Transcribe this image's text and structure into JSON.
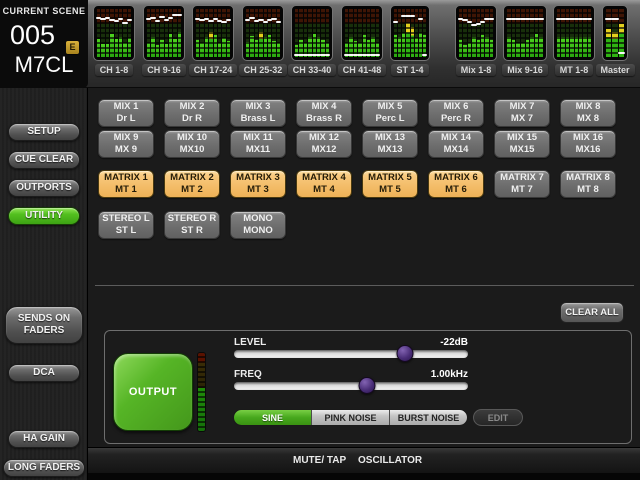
{
  "scene": {
    "label": "CURRENT SCENE",
    "number": "005",
    "edit_badge": "E",
    "model": "M7CL"
  },
  "meters": {
    "blocks": [
      {
        "label": "CH 1-8",
        "bars": [
          38,
          28,
          28,
          48,
          38,
          42,
          30,
          40
        ],
        "markers": [
          80,
          77,
          80,
          74,
          72,
          77,
          68,
          74
        ],
        "yellow": []
      },
      {
        "label": "CH 9-16",
        "bars": [
          30,
          42,
          25,
          35,
          28,
          48,
          38,
          52
        ],
        "markers": [
          77,
          80,
          72,
          82,
          75,
          80,
          85,
          85
        ],
        "yellow": []
      },
      {
        "label": "CH 17-24",
        "bars": [
          36,
          30,
          42,
          52,
          46,
          30,
          40,
          34
        ],
        "markers": [
          78,
          74,
          77,
          72,
          78,
          73,
          70,
          76
        ],
        "yellow": [
          3
        ]
      },
      {
        "label": "CH 25-32",
        "bars": [
          32,
          44,
          36,
          52,
          42,
          46,
          34,
          30
        ],
        "markers": [
          76,
          79,
          73,
          76,
          71,
          74,
          78,
          71
        ],
        "yellow": [
          3
        ]
      },
      {
        "label": "CH 33-40",
        "bars": [
          26,
          36,
          30,
          42,
          48,
          42,
          36,
          30
        ],
        "markers": [
          3,
          3,
          3,
          3,
          3,
          3,
          3,
          3
        ],
        "yellow": []
      },
      {
        "label": "CH 41-48",
        "bars": [
          30,
          42,
          34,
          30,
          46,
          36,
          42,
          30
        ],
        "markers": [
          3,
          3,
          3,
          3,
          3,
          3,
          3,
          3
        ],
        "yellow": []
      },
      {
        "label": "ST 1-4",
        "bars": [
          46,
          42,
          50,
          70,
          62,
          40,
          50,
          46
        ],
        "markers": [
          70,
          null,
          84,
          84,
          84,
          null,
          78,
          3
        ],
        "yellow": [
          3,
          4
        ]
      },
      {
        "label": "Mix 1-8",
        "bars": [
          36,
          26,
          30,
          42,
          36,
          46,
          42,
          36
        ],
        "markers": [
          78,
          74,
          70,
          64,
          67,
          71,
          77,
          77
        ],
        "yellow": []
      },
      {
        "label": "Mix 9-16",
        "bars": [
          42,
          36,
          30,
          30,
          36,
          42,
          48,
          42
        ],
        "markers": [
          77,
          77,
          77,
          77,
          77,
          77,
          77,
          77
        ],
        "yellow": []
      },
      {
        "label": "MT 1-8",
        "bars": [
          42,
          42,
          42,
          42,
          42,
          42,
          42,
          42
        ],
        "markers": [
          77,
          77,
          77,
          77,
          77,
          77,
          77,
          77
        ],
        "yellow": []
      },
      {
        "label": "Master",
        "bars": [
          58,
          52,
          68
        ],
        "markers": [
          78,
          78,
          6
        ],
        "yellow": [
          0,
          1,
          2
        ]
      }
    ]
  },
  "sidebar": {
    "items": [
      {
        "label": "SETUP",
        "active": false
      },
      {
        "label": "CUE CLEAR",
        "active": false
      },
      {
        "label": "OUTPORTS",
        "active": false
      },
      {
        "label": "UTILITY",
        "active": true
      },
      {
        "label": "SENDS ON\nFADERS",
        "active": false
      },
      {
        "label": "DCA",
        "active": false
      },
      {
        "label": "HA GAIN",
        "active": false
      },
      {
        "label": "LONG FADERS",
        "active": false
      }
    ]
  },
  "channel_grid": {
    "rows": [
      [
        {
          "line1": "MIX 1",
          "line2": "Dr L",
          "state": "gray"
        },
        {
          "line1": "MIX 2",
          "line2": "Dr R",
          "state": "gray"
        },
        {
          "line1": "MIX 3",
          "line2": "Brass L",
          "state": "gray"
        },
        {
          "line1": "MIX 4",
          "line2": "Brass R",
          "state": "gray"
        },
        {
          "line1": "MIX 5",
          "line2": "Perc L",
          "state": "gray"
        },
        {
          "line1": "MIX 6",
          "line2": "Perc R",
          "state": "gray"
        },
        {
          "line1": "MIX 7",
          "line2": "MX 7",
          "state": "gray"
        },
        {
          "line1": "MIX 8",
          "line2": "MX 8",
          "state": "gray"
        }
      ],
      [
        {
          "line1": "MIX 9",
          "line2": "MX 9",
          "state": "gray"
        },
        {
          "line1": "MIX 10",
          "line2": "MX10",
          "state": "gray"
        },
        {
          "line1": "MIX 11",
          "line2": "MX11",
          "state": "gray"
        },
        {
          "line1": "MIX 12",
          "line2": "MX12",
          "state": "gray"
        },
        {
          "line1": "MIX 13",
          "line2": "MX13",
          "state": "gray"
        },
        {
          "line1": "MIX 14",
          "line2": "MX14",
          "state": "gray"
        },
        {
          "line1": "MIX 15",
          "line2": "MX15",
          "state": "gray"
        },
        {
          "line1": "MIX 16",
          "line2": "MX16",
          "state": "gray"
        }
      ],
      [
        {
          "line1": "MATRIX 1",
          "line2": "MT 1",
          "state": "orange"
        },
        {
          "line1": "MATRIX 2",
          "line2": "MT 2",
          "state": "orange"
        },
        {
          "line1": "MATRIX 3",
          "line2": "MT 3",
          "state": "orange"
        },
        {
          "line1": "MATRIX 4",
          "line2": "MT 4",
          "state": "orange"
        },
        {
          "line1": "MATRIX 5",
          "line2": "MT 5",
          "state": "orange"
        },
        {
          "line1": "MATRIX 6",
          "line2": "MT 6",
          "state": "orange"
        },
        {
          "line1": "MATRIX 7",
          "line2": "MT 7",
          "state": "gray"
        },
        {
          "line1": "MATRIX 8",
          "line2": "MT 8",
          "state": "gray"
        }
      ],
      [
        {
          "line1": "STEREO L",
          "line2": "ST L",
          "state": "gray"
        },
        {
          "line1": "STEREO R",
          "line2": "ST R",
          "state": "gray"
        },
        {
          "line1": "MONO",
          "line2": "MONO",
          "state": "gray"
        }
      ]
    ]
  },
  "clear_all_label": "CLEAR ALL",
  "oscillator": {
    "output_label": "OUTPUT",
    "level_label": "LEVEL",
    "level_value": "-22dB",
    "level_percent": 73,
    "freq_label": "FREQ",
    "freq_value": "1.00kHz",
    "freq_percent": 57,
    "modes": [
      {
        "label": "SINE",
        "selected": true
      },
      {
        "label": "PINK NOISE",
        "selected": false
      },
      {
        "label": "BURST NOISE",
        "selected": false
      }
    ],
    "edit_label": "EDIT"
  },
  "bottom_bar": {
    "tabs": [
      {
        "label": "MUTE/ TAP"
      },
      {
        "label": "OSCILLATOR"
      }
    ]
  },
  "colors": {
    "accent_green": "#4cb11e",
    "selected_orange": "#f3bc68",
    "meter_green": "#2fb312",
    "slider_handle_purple": "#4a2e78",
    "scene_badge_gold": "#c9a227"
  }
}
